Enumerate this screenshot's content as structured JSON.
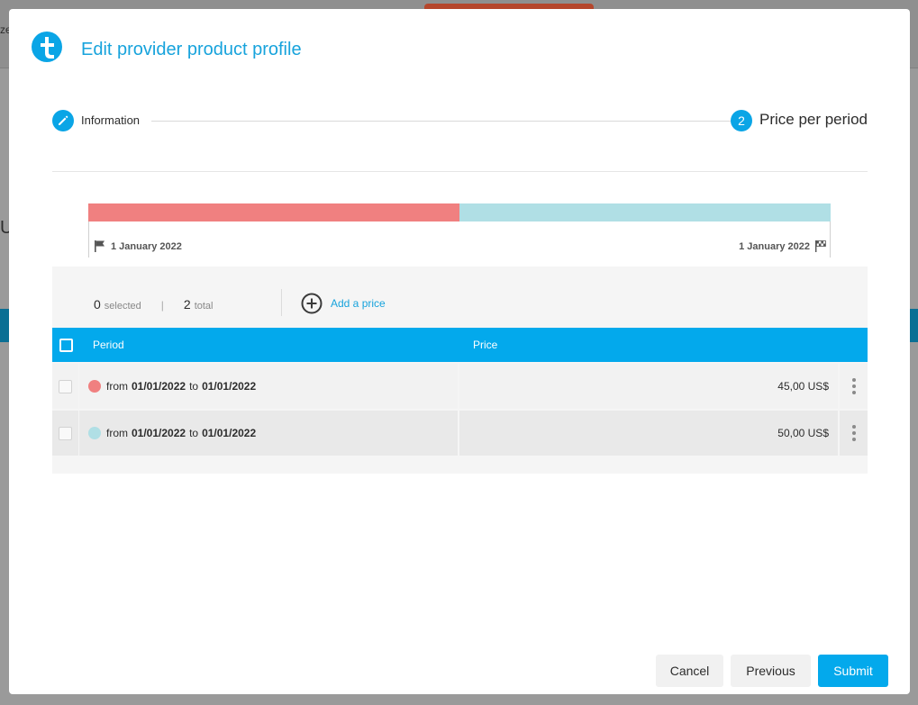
{
  "background": {
    "partial_text_top": "ze",
    "partial_text_mid": "U"
  },
  "modal": {
    "title": "Edit provider product profile",
    "logo_icon": "brand-cross-icon"
  },
  "stepper": {
    "step1_label": "Information",
    "step1_icon": "pencil-icon",
    "step2_number": "2",
    "step2_label": "Price per period"
  },
  "timeline": {
    "start_label": "1 January 2022",
    "end_label": "1 January 2022",
    "start_icon": "flag-icon",
    "end_icon": "checkered-flag-icon",
    "segments": [
      {
        "color": "#f08080",
        "share": 0.5
      },
      {
        "color": "#b0dfe5",
        "share": 0.5
      }
    ]
  },
  "list": {
    "selected_count": "0",
    "selected_label": "selected",
    "separator": "|",
    "total_count": "2",
    "total_label": "total",
    "add_label": "Add a price"
  },
  "table": {
    "headers": {
      "period": "Period",
      "price": "Price"
    },
    "rows": [
      {
        "color": "#f08080",
        "from_word": "from",
        "start": "01/01/2022",
        "to_word": "to",
        "end": "01/01/2022",
        "price": "45,00 US$"
      },
      {
        "color": "#b0dfe5",
        "from_word": "from",
        "start": "01/01/2022",
        "to_word": "to",
        "end": "01/01/2022",
        "price": "50,00 US$"
      }
    ]
  },
  "footer": {
    "cancel": "Cancel",
    "previous": "Previous",
    "submit": "Submit"
  },
  "colors": {
    "accent": "#03a9ec",
    "title": "#17a3dc"
  }
}
